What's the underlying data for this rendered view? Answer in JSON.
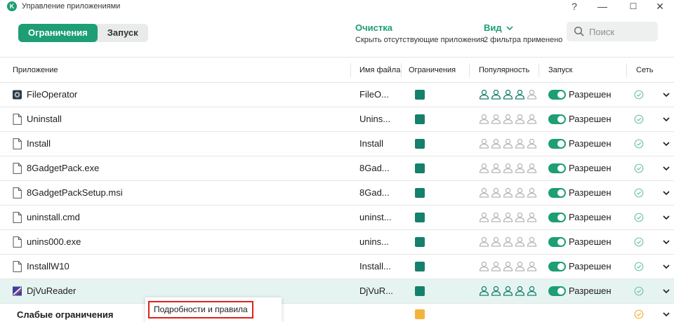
{
  "window": {
    "title": "Управление приложениями",
    "help": "?",
    "minimize": "—",
    "maximize": "☐",
    "close": "✕"
  },
  "toolbar": {
    "tabs": [
      {
        "label": "Ограничения",
        "active": true
      },
      {
        "label": "Запуск",
        "active": false
      }
    ],
    "cleanup": {
      "title": "Очистка",
      "subtitle": "Скрыть отсутствующие приложения"
    },
    "view": {
      "title": "Вид",
      "subtitle": "2 фильтра применено"
    },
    "search": {
      "placeholder": "Поиск"
    }
  },
  "table": {
    "columns": {
      "app": "Приложение",
      "file": "Имя файла",
      "limits": "Ограничения",
      "popularity": "Популярность",
      "launch": "Запуск",
      "network": "Сеть"
    },
    "rows": [
      {
        "name": "FileOperator",
        "file": "FileO...",
        "icon": "fileoperator-app-icon",
        "popularity": 4,
        "launch": "Разрешен"
      },
      {
        "name": "Uninstall",
        "file": "Unins...",
        "icon": "file-icon",
        "popularity": 0,
        "launch": "Разрешен"
      },
      {
        "name": "Install",
        "file": "Install",
        "icon": "file-icon",
        "popularity": 0,
        "launch": "Разрешен"
      },
      {
        "name": "8GadgetPack.exe",
        "file": "8Gad...",
        "icon": "file-icon",
        "popularity": 0,
        "launch": "Разрешен"
      },
      {
        "name": "8GadgetPackSetup.msi",
        "file": "8Gad...",
        "icon": "file-icon",
        "popularity": 0,
        "launch": "Разрешен"
      },
      {
        "name": "uninstall.cmd",
        "file": "uninst...",
        "icon": "file-icon",
        "popularity": 0,
        "launch": "Разрешен"
      },
      {
        "name": "unins000.exe",
        "file": "unins...",
        "icon": "file-icon",
        "popularity": 0,
        "launch": "Разрешен"
      },
      {
        "name": "InstallW10",
        "file": "Install...",
        "icon": "file-icon",
        "popularity": 0,
        "launch": "Разрешен"
      },
      {
        "name": "DjVuReader",
        "file": "DjVuR...",
        "icon": "djvureader-app-icon",
        "popularity": 5,
        "launch": "Разрешен",
        "selected": true
      }
    ],
    "group": {
      "label": "Слабые ограничения"
    }
  },
  "context_menu": {
    "item": "Подробности и правила"
  },
  "colors": {
    "accent": "#1d9e75",
    "restriction_trusted": "#15806b",
    "restriction_weak": "#f3b43e",
    "highlight_border": "#e0201b"
  }
}
